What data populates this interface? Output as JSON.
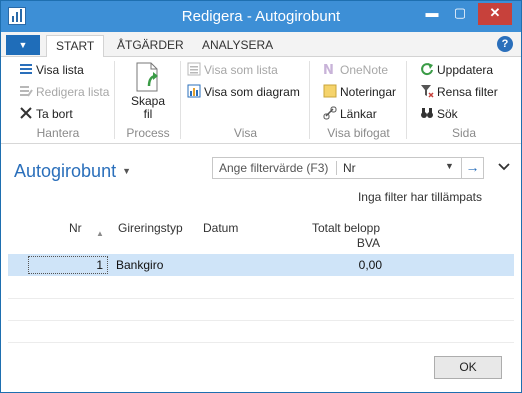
{
  "window": {
    "title": "Redigera - Autogirobunt",
    "minimize": "▬",
    "maximize": "▢",
    "close": "✕"
  },
  "ribbon_tabs": [
    {
      "label": "START"
    },
    {
      "label": "ÅTGÄRDER"
    },
    {
      "label": "ANALYSERA"
    }
  ],
  "app_menu": "▼",
  "help": "?",
  "ribbon": {
    "hantera": {
      "label": "Hantera",
      "visa_lista": "Visa lista",
      "redigera_lista": "Redigera lista",
      "ta_bort": "Ta bort"
    },
    "process": {
      "label": "Process",
      "skapa_fil_1": "Skapa",
      "skapa_fil_2": "fil"
    },
    "visa": {
      "label": "Visa",
      "visa_som_lista": "Visa som lista",
      "visa_som_diagram": "Visa som diagram"
    },
    "visa_bifogat": {
      "label": "Visa bifogat",
      "onenote": "OneNote",
      "noteringar": "Noteringar",
      "lankar": "Länkar"
    },
    "sida": {
      "label": "Sida",
      "uppdatera": "Uppdatera",
      "rensa_filter": "Rensa filter",
      "sok": "Sök"
    }
  },
  "page": {
    "title": "Autogirobunt",
    "filter_placeholder": "Ange filtervärde (F3)",
    "filter_field": "Nr",
    "no_filter": "Inga filter har tillämpats"
  },
  "table": {
    "headers": {
      "nr": "Nr",
      "typ": "Gireringstyp",
      "datum": "Datum",
      "belopp1": "Totalt belopp",
      "belopp2": "BVA"
    },
    "rows": [
      {
        "nr": "1",
        "typ": "Bankgiro",
        "datum": "",
        "belopp": "0,00"
      }
    ]
  },
  "ok_label": "OK",
  "colors": {
    "accent": "#2a6fbb",
    "titlebar": "#3d8fd6",
    "selected_row": "#cfe4f8",
    "close": "#c7413b"
  }
}
